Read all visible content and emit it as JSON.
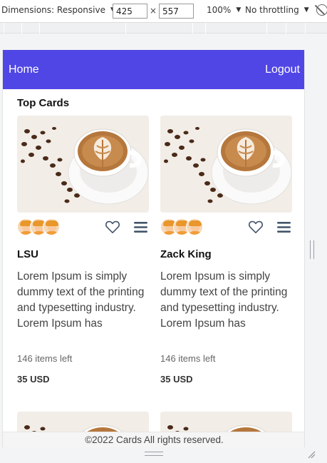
{
  "devtools": {
    "dimensions_label": "Dimensions: Responsive",
    "width_value": "425",
    "height_value": "557",
    "times": "×",
    "zoom": "100%",
    "throttling": "No throttling"
  },
  "navbar": {
    "home": "Home",
    "logout": "Logout",
    "color": "#5046e5"
  },
  "section": {
    "title": "Top Cards"
  },
  "cards": [
    {
      "title": "LSU",
      "description": "Lorem Ipsum is simply dummy text of the printing and typesetting industry. Lorem Ipsum has",
      "stock": "146 items left",
      "price": "35 USD",
      "image": "coffee-latte-image",
      "avatars": 3
    },
    {
      "title": "Zack King",
      "description": "Lorem Ipsum is simply dummy text of the printing and typesetting industry. Lorem Ipsum has",
      "stock": "146 items left",
      "price": "35 USD",
      "image": "coffee-latte-image",
      "avatars": 3
    }
  ],
  "footer": {
    "text": "©2022 Cards All rights reserved."
  }
}
